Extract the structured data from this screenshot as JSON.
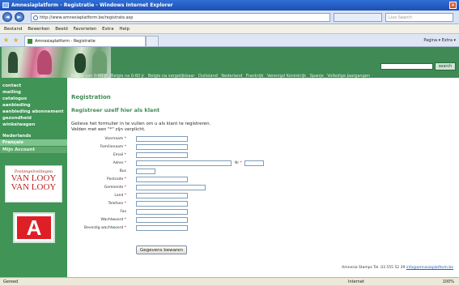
{
  "window": {
    "title": "Amnesiaplatform - Registratie - Windows Internet Explorer",
    "close_glyph": "×"
  },
  "address_bar": {
    "url": "http://www.amnesiaplatform.be/registrate.asp",
    "search_placeholder": "Live Search",
    "back_glyph": "◄",
    "forward_glyph": "►"
  },
  "menu": [
    "Bestand",
    "Bewerken",
    "Beeld",
    "Favorieten",
    "Extra",
    "Help"
  ],
  "tabs": {
    "active_label": "Amnesiaplatform - Registratie",
    "tools": "Pagina ▾  Extra ▾"
  },
  "site": {
    "search_button": "search",
    "topnav": [
      "Belgie van 0-60 jr",
      "Belgie na 0-60 jr",
      "Belgie na vergelijkbaar",
      "Duitsland",
      "Nederland",
      "Frankrijk",
      "Verenigd Koninkrijk",
      "Spanje",
      "Volledige Jaargangen"
    ],
    "sidebar": {
      "group1": [
        "contact",
        "mailing",
        "catalogus",
        "aanbieding",
        "aanbieding abonnement",
        "gezondheid",
        "winkelwagen"
      ],
      "group2": [
        "Nederlands",
        "Français",
        "Mijn Account"
      ]
    },
    "promo": {
      "tagline": "Postzegelveilingen",
      "name_line1": "VAN LOOY",
      "name_line2": "VAN LOOY"
    },
    "logo_letter": "A"
  },
  "form": {
    "heading": "Registration",
    "subheading": "Registreer uzelf hier als klant",
    "intro_line1": "Gelieve het formulier in te vullen om u als klant te registreren.",
    "intro_line2": "Velden met een \"*\" zijn verplicht.",
    "required_mark": "*",
    "fields": [
      {
        "label": "Voornaam"
      },
      {
        "label": "Familienaam"
      },
      {
        "label": "Email"
      },
      {
        "label": "Adres"
      },
      {
        "label": "Bus"
      },
      {
        "label": "Postcode"
      },
      {
        "label": "Gemeente"
      },
      {
        "label": "Land"
      },
      {
        "label": "Telefoon"
      },
      {
        "label": "Fax"
      },
      {
        "label": "Wachtwoord"
      },
      {
        "label": "Bevestig wachtwoord"
      }
    ],
    "nr_label": "Nr",
    "submit_label": "Gegevens bewaren"
  },
  "footer": {
    "text": "Amnesia Stamps Tel. 03 555 52 39",
    "link": "info@amnesiaplatform.be"
  },
  "status": {
    "left": "Gereed",
    "zone": "Internet",
    "zoom": "100%"
  }
}
